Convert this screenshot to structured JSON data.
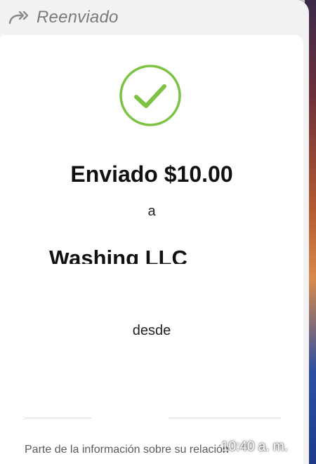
{
  "header": {
    "forwarded_label": "Reenviado",
    "forward_icon": "forward-arrow-icon"
  },
  "receipt": {
    "status_icon": "check-circle-icon",
    "accent_color": "#7cc243",
    "headline": "Enviado $10.00",
    "to_label": "a",
    "recipient_name": "Washing LLC",
    "from_label": "desde",
    "footnote": "Parte de la información sobre su relación"
  },
  "message": {
    "timestamp": "10:40 a. m."
  }
}
